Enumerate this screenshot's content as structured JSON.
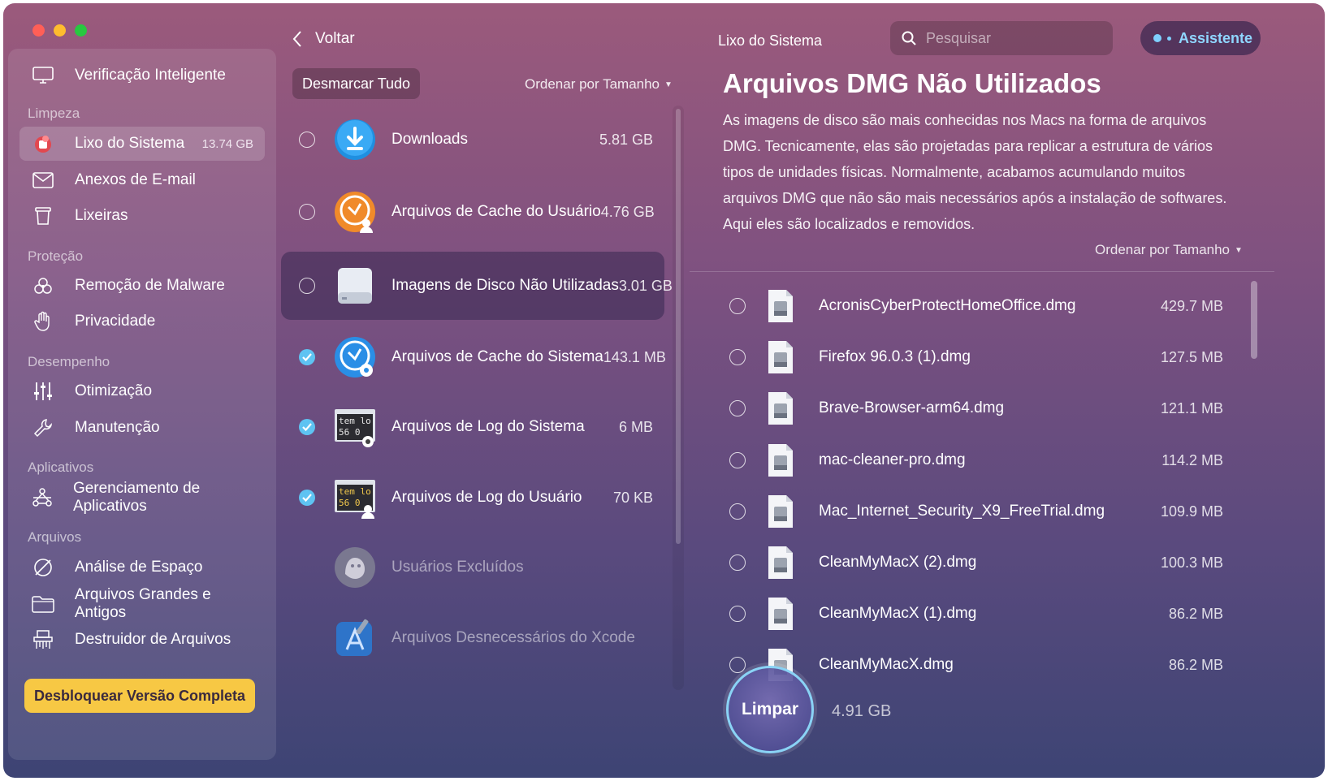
{
  "sidebar": {
    "top_item": {
      "label": "Verificação Inteligente",
      "icon": "monitor-icon"
    },
    "sections": [
      {
        "title": "Limpeza"
      },
      {
        "title": "Proteção"
      },
      {
        "title": "Desempenho"
      },
      {
        "title": "Aplicativos"
      },
      {
        "title": "Arquivos"
      }
    ],
    "items": [
      {
        "label": "Lixo do Sistema",
        "badge": "13.74 GB",
        "icon": "trash-bin-icon",
        "active": true
      },
      {
        "label": "Anexos de E-mail",
        "icon": "envelope-icon"
      },
      {
        "label": "Lixeiras",
        "icon": "bin-icon"
      },
      {
        "label": "Remoção de Malware",
        "icon": "biohazard-icon"
      },
      {
        "label": "Privacidade",
        "icon": "hand-icon"
      },
      {
        "label": "Otimização",
        "icon": "sliders-icon"
      },
      {
        "label": "Manutenção",
        "icon": "wrench-icon"
      },
      {
        "label": "Gerenciamento de Aplicativos",
        "icon": "apps-icon"
      },
      {
        "label": "Análise de Espaço",
        "icon": "space-lens-icon"
      },
      {
        "label": "Arquivos Grandes e Antigos",
        "icon": "folder-icon"
      },
      {
        "label": "Destruidor de Arquivos",
        "icon": "shredder-icon"
      }
    ],
    "unlock_label": "Desbloquear Versão Completa"
  },
  "middle": {
    "back_label": "Voltar",
    "deselect_label": "Desmarcar Tudo",
    "sort_label": "Ordenar por Tamanho",
    "categories": [
      {
        "label": "Downloads",
        "size": "5.81 GB",
        "state": "unchecked",
        "icon": "download-icon"
      },
      {
        "label": "Arquivos de Cache do Usuário",
        "size": "4.76 GB",
        "state": "unchecked",
        "icon": "user-cache-icon"
      },
      {
        "label": "Imagens de Disco Não Utilizadas",
        "size": "3.01 GB",
        "state": "unchecked",
        "icon": "disk-image-icon"
      },
      {
        "label": "Arquivos de Cache do Sistema",
        "size": "143.1 MB",
        "state": "checked",
        "icon": "system-cache-icon"
      },
      {
        "label": "Arquivos de Log do Sistema",
        "size": "6 MB",
        "state": "checked",
        "icon": "system-log-icon"
      },
      {
        "label": "Arquivos de Log do Usuário",
        "size": "70 KB",
        "state": "checked",
        "icon": "user-log-icon"
      },
      {
        "label": "Usuários Excluídos",
        "size": "",
        "state": "none",
        "icon": "deleted-users-icon"
      },
      {
        "label": "Arquivos Desnecessários do Xcode",
        "size": "",
        "state": "none",
        "icon": "xcode-icon"
      }
    ],
    "log_icon_text": [
      "tem lo",
      "56 0"
    ]
  },
  "right": {
    "title": "Lixo do Sistema",
    "search_placeholder": "Pesquisar",
    "assistant_label": "Assistente",
    "heading": "Arquivos DMG Não Utilizados",
    "description": "As imagens de disco são mais conhecidas nos Macs na forma de arquivos DMG. Tecnicamente, elas são projetadas para replicar a estrutura de vários tipos de unidades físicas. Normalmente, acabamos acumulando muitos arquivos DMG que não são mais necessários após a instalação de softwares. Aqui eles são localizados e removidos.",
    "sort_label": "Ordenar por Tamanho",
    "files": [
      {
        "name": "AcronisCyberProtectHomeOffice.dmg",
        "size": "429.7 MB"
      },
      {
        "name": "Firefox 96.0.3 (1).dmg",
        "size": "127.5 MB"
      },
      {
        "name": "Brave-Browser-arm64.dmg",
        "size": "121.1 MB"
      },
      {
        "name": "mac-cleaner-pro.dmg",
        "size": "114.2 MB"
      },
      {
        "name": "Mac_Internet_Security_X9_FreeTrial.dmg",
        "size": "109.9 MB"
      },
      {
        "name": "CleanMyMacX (2).dmg",
        "size": "100.3 MB"
      },
      {
        "name": "CleanMyMacX (1).dmg",
        "size": "86.2 MB"
      },
      {
        "name": "CleanMyMacX.dmg",
        "size": "86.2 MB"
      }
    ],
    "clean_label": "Limpar",
    "clean_size": "4.91 GB"
  },
  "colors": {
    "accent": "#5ec3f2",
    "unlock": "#f7c844",
    "assistant": "#8fd6ff"
  }
}
